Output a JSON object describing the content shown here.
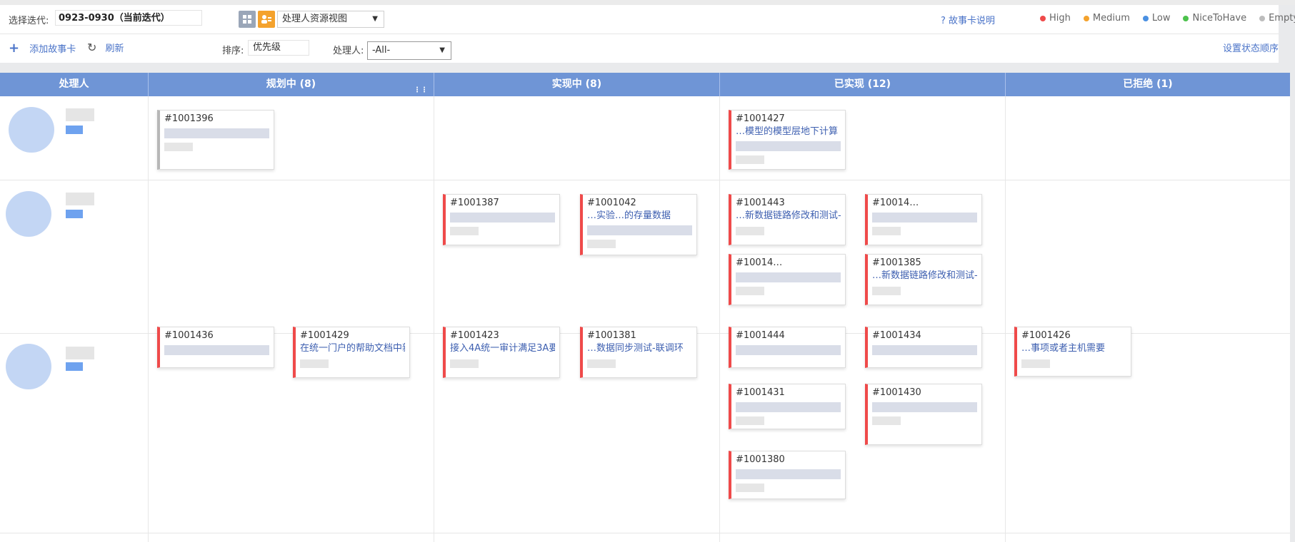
{
  "toolbar": {
    "iteration_label": "选择迭代:",
    "iteration_value": "0923-0930（当前迭代）",
    "view_select": "处理人资源视图",
    "help_link": "故事卡说明",
    "add_card": "添加故事卡",
    "refresh": "刷新",
    "sort_label": "排序:",
    "sort_value": "优先级",
    "assignee_label": "处理人:",
    "assignee_value": "-All-",
    "status_order_link": "设置状态顺序"
  },
  "legend": [
    {
      "label": "High",
      "color": "#ef4a4a"
    },
    {
      "label": "Medium",
      "color": "#f4a22d"
    },
    {
      "label": "Low",
      "color": "#4a90e2"
    },
    {
      "label": "NiceToHave",
      "color": "#4cc24c"
    },
    {
      "label": "Empty",
      "color": "#bdbdbd"
    }
  ],
  "columns": {
    "assignee": "处理人",
    "planning": "规划中 (8)",
    "implementing": "实现中 (8)",
    "implemented": "已实现 (12)",
    "rejected": "已拒绝 (1)"
  },
  "cards": {
    "c1001396": {
      "id": "#1001396",
      "title": ""
    },
    "c1001427": {
      "id": "#1001427",
      "title": "…模型的模型层地下计算"
    },
    "c1001387": {
      "id": "#1001387",
      "title": ""
    },
    "c1001042": {
      "id": "#1001042",
      "title": "…实验…的存量数据"
    },
    "c1001443": {
      "id": "#1001443",
      "title": "…新数据链路修改和测试-"
    },
    "c10014xx": {
      "id": "#10014…",
      "title": ""
    },
    "c10014yy": {
      "id": "#10014…",
      "title": ""
    },
    "c1001385": {
      "id": "#1001385",
      "title": "…新数据链路修改和测试-"
    },
    "c1001436": {
      "id": "#1001436",
      "title": ""
    },
    "c1001429": {
      "id": "#1001429",
      "title": "在统一门户的帮助文档中新"
    },
    "c1001423": {
      "id": "#1001423",
      "title": "接入4A统一审计满足3A要"
    },
    "c1001381": {
      "id": "#1001381",
      "title": "…数据同步测试-联调环"
    },
    "c1001444": {
      "id": "#1001444",
      "title": ""
    },
    "c1001434": {
      "id": "#1001434",
      "title": ""
    },
    "c1001426": {
      "id": "#1001426",
      "title": "…事项或者主机需要"
    },
    "c1001431": {
      "id": "#1001431",
      "title": ""
    },
    "c1001430": {
      "id": "#1001430",
      "title": ""
    },
    "c1001380": {
      "id": "#1001380",
      "title": ""
    }
  }
}
